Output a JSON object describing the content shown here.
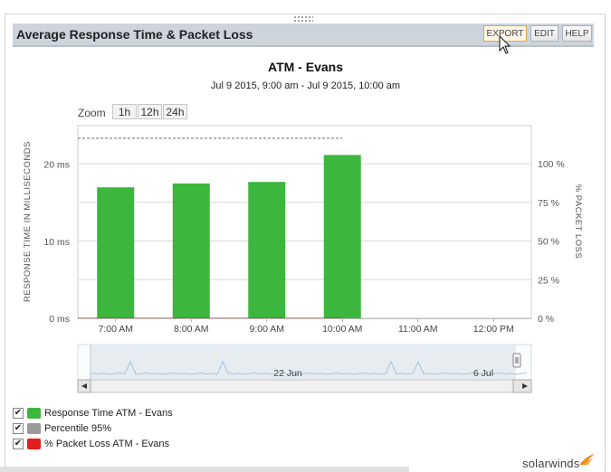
{
  "panel": {
    "title": "Average Response Time & Packet Loss",
    "buttons": {
      "export": "EXPORT",
      "edit": "EDIT",
      "help": "HELP"
    }
  },
  "chart": {
    "title": "ATM - Evans",
    "subtitle": "Jul 9 2015, 9:00 am - Jul 9 2015, 10:00 am",
    "zoom_label": "Zoom",
    "zoom_options": [
      "1h",
      "12h",
      "24h"
    ]
  },
  "chart_data": {
    "type": "bar",
    "categories": [
      "7:00 AM",
      "8:00 AM",
      "9:00 AM",
      "10:00 AM",
      "11:00 AM",
      "12:00 PM"
    ],
    "series": [
      {
        "name": "Response Time ATM - Evans",
        "values": [
          17,
          17.5,
          17.7,
          21.2,
          null,
          null
        ],
        "color": "#3cb63c"
      }
    ],
    "percentile_95": 25,
    "percentile_until_category": "10:00 AM",
    "ylabel": "RESPONSE TIME IN MILLISECONDS",
    "ylabel_right": "% PACKET LOSS",
    "ylim": [
      0,
      25
    ],
    "yticks": [
      "0 ms",
      "10 ms",
      "20 ms"
    ],
    "ylim_right": [
      0,
      100
    ],
    "yticks_right": [
      "0 %",
      "25 %",
      "50 %",
      "75 %",
      "100 %"
    ],
    "grid": true
  },
  "navigator": {
    "labels": [
      "22 Jun",
      "6 Jul"
    ]
  },
  "legend": [
    {
      "label": "Response Time ATM - Evans",
      "color": "#3cb63c",
      "checked": true
    },
    {
      "label": "Percentile 95%",
      "color": "#9a9a9a",
      "checked": true
    },
    {
      "label": "% Packet Loss ATM - Evans",
      "color": "#e31e1e",
      "checked": true
    }
  ],
  "brand": {
    "name": "solarwinds"
  }
}
